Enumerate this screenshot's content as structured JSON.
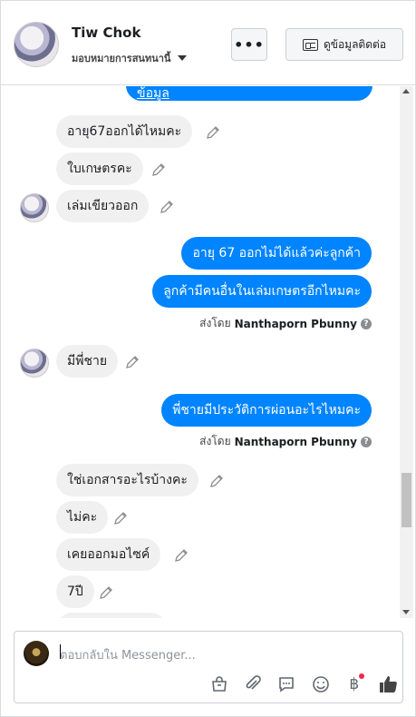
{
  "header": {
    "name": "Tiw Chok",
    "assign_label": "มอบหมายการสนทนานี้",
    "more_label": "•••",
    "contact_label": "ดูข้อมูลติดต่อ"
  },
  "thread": {
    "top_partial_text": "ข้อมูล",
    "messages_in_1": [
      "อายุ67ออกได้ไหมคะ",
      "ใบเกษตรคะ",
      "เล่มเขียวออก"
    ],
    "messages_out_1": [
      "อายุ 67 ออกไม่ได้แล้วค่ะลูกค้า",
      "ลูกค้ามีคนอื่นในเล่มเกษตรอีกไหมคะ"
    ],
    "sent_by_prefix": "ส่งโดย",
    "sent_by_name": "Nanthaporn Pbunny",
    "messages_in_2": [
      "มีพี่ชาย"
    ],
    "messages_out_2": [
      "พี่ชายมีประวัติการผ่อนอะไรไหมคะ"
    ],
    "messages_in_3": [
      "ใช่เอกสารอะไรบ้างคะ",
      "ไม่คะ",
      "เคยออกมอไซค์",
      "7ปี"
    ]
  },
  "composer": {
    "placeholder": "ตอบกลับใน Messenger..."
  },
  "colors": {
    "brand_blue": "#0084ff",
    "incoming_bubble": "#f1f0f0"
  }
}
